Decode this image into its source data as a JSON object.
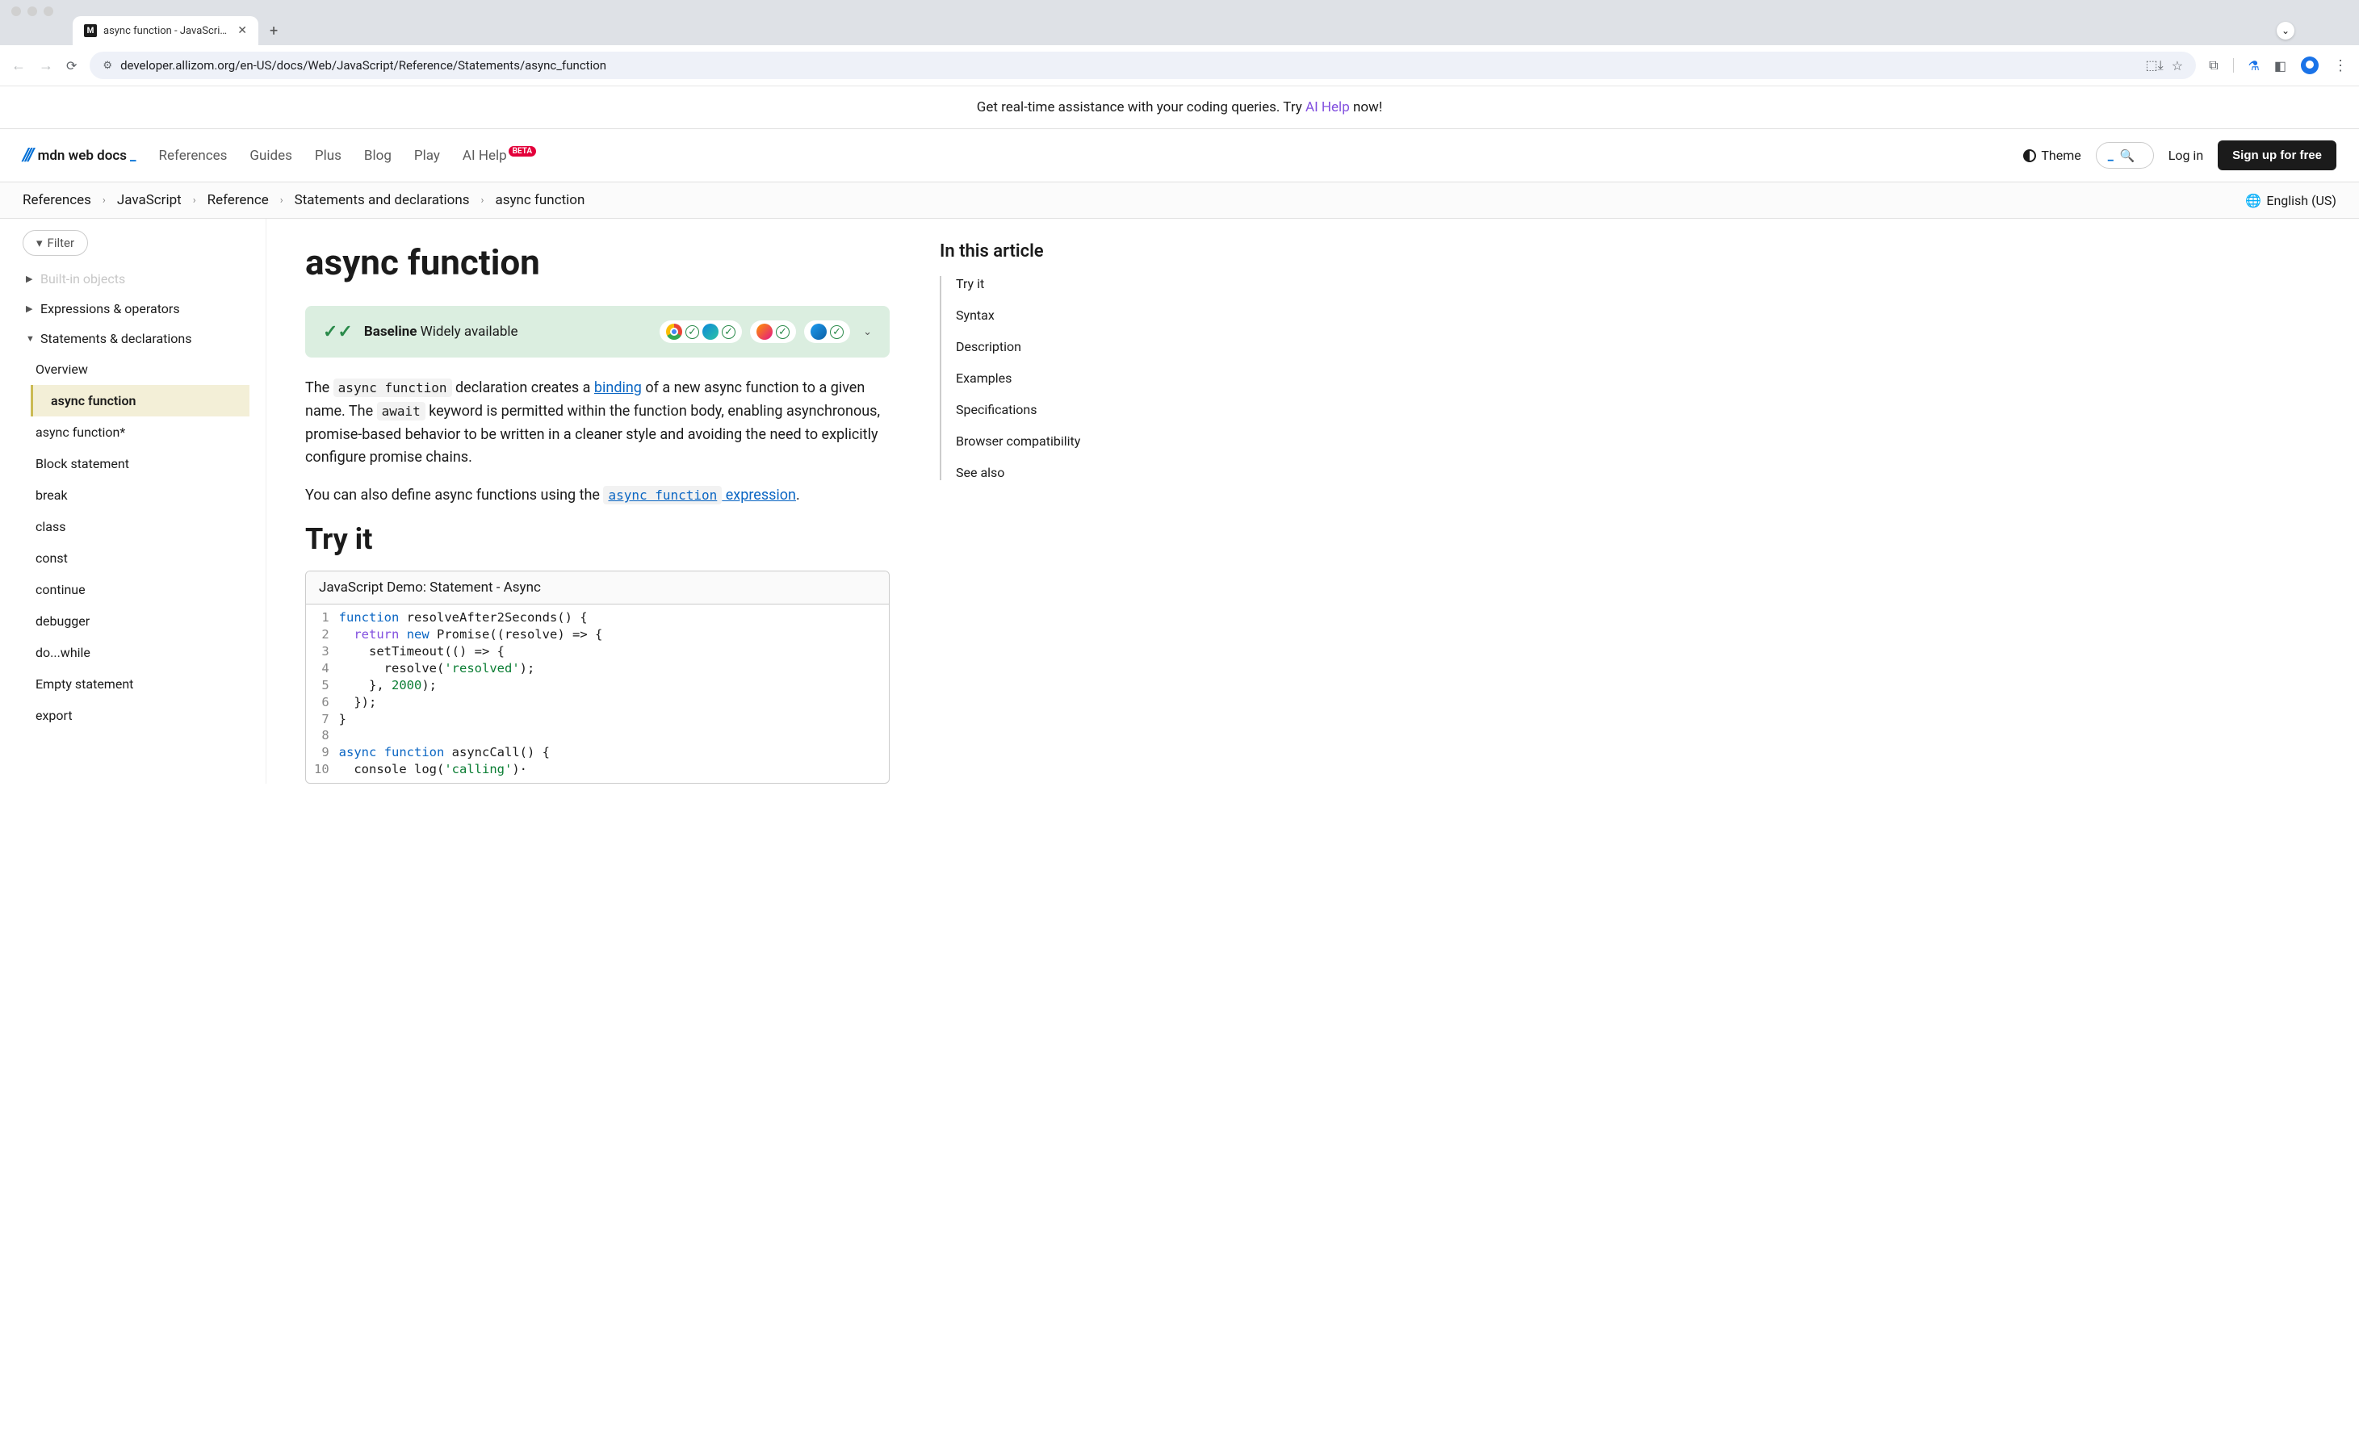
{
  "browser": {
    "tab_title": "async function - JavaScript |",
    "url": "developer.allizom.org/en-US/docs/Web/JavaScript/Reference/Statements/async_function"
  },
  "promo": {
    "pre": "Get real-time assistance with your coding queries. Try ",
    "link": "AI Help",
    "post": " now!"
  },
  "header": {
    "logo_text": "mdn web docs",
    "nav": [
      "References",
      "Guides",
      "Plus",
      "Blog",
      "Play",
      "AI Help"
    ],
    "ai_help_badge": "BETA",
    "theme_label": "Theme",
    "login": "Log in",
    "signup": "Sign up for free"
  },
  "breadcrumbs": [
    "References",
    "JavaScript",
    "Reference",
    "Statements and declarations",
    "async function"
  ],
  "language": "English (US)",
  "sidebar": {
    "filter_label": "Filter",
    "items": [
      {
        "label": "Built-in objects",
        "expanded": false,
        "faded": true
      },
      {
        "label": "Expressions & operators",
        "expanded": false
      },
      {
        "label": "Statements & declarations",
        "expanded": true,
        "children": [
          {
            "label": "Overview"
          },
          {
            "label": "async function",
            "active": true
          },
          {
            "label": "async function*"
          },
          {
            "label": "Block statement"
          },
          {
            "label": "break"
          },
          {
            "label": "class"
          },
          {
            "label": "const"
          },
          {
            "label": "continue"
          },
          {
            "label": "debugger"
          },
          {
            "label": "do...while"
          },
          {
            "label": "Empty statement"
          },
          {
            "label": "export"
          }
        ]
      }
    ]
  },
  "page": {
    "title": "async function",
    "baseline_strong": "Baseline",
    "baseline_rest": " Widely available",
    "intro_1_pre": "The ",
    "intro_1_code1": "async function",
    "intro_1_mid1": " declaration creates a ",
    "intro_1_link1": "binding",
    "intro_1_mid2": " of a new async function to a given name. The ",
    "intro_1_code2": "await",
    "intro_1_tail": " keyword is permitted within the function body, enabling asynchronous, promise-based behavior to be written in a cleaner style and avoiding the need to explicitly configure promise chains.",
    "intro_2_pre": "You can also define async functions using the ",
    "intro_2_linkcode": "async function",
    "intro_2_linktext": " expression",
    "intro_2_tail": ".",
    "try_it_heading": "Try it",
    "demo_header": "JavaScript Demo: Statement - Async",
    "code_lines": [
      {
        "n": "1",
        "tokens": [
          {
            "t": "function",
            "c": "kw"
          },
          {
            "t": " resolveAfter2Seconds() {",
            "c": ""
          }
        ]
      },
      {
        "n": "2",
        "tokens": [
          {
            "t": "  ",
            "c": ""
          },
          {
            "t": "return",
            "c": "kw2"
          },
          {
            "t": " ",
            "c": ""
          },
          {
            "t": "new",
            "c": "kw"
          },
          {
            "t": " Promise((resolve) => {",
            "c": ""
          }
        ]
      },
      {
        "n": "3",
        "tokens": [
          {
            "t": "    setTimeout(() => {",
            "c": ""
          }
        ]
      },
      {
        "n": "4",
        "tokens": [
          {
            "t": "      resolve(",
            "c": ""
          },
          {
            "t": "'resolved'",
            "c": "str"
          },
          {
            "t": ");",
            "c": ""
          }
        ]
      },
      {
        "n": "5",
        "tokens": [
          {
            "t": "    }, ",
            "c": ""
          },
          {
            "t": "2000",
            "c": "num"
          },
          {
            "t": ");",
            "c": ""
          }
        ]
      },
      {
        "n": "6",
        "tokens": [
          {
            "t": "  });",
            "c": ""
          }
        ]
      },
      {
        "n": "7",
        "tokens": [
          {
            "t": "}",
            "c": ""
          }
        ]
      },
      {
        "n": "8",
        "tokens": [
          {
            "t": "",
            "c": ""
          }
        ]
      },
      {
        "n": "9",
        "tokens": [
          {
            "t": "async",
            "c": "kw"
          },
          {
            "t": " ",
            "c": ""
          },
          {
            "t": "function",
            "c": "kw"
          },
          {
            "t": " asyncCall() {",
            "c": ""
          }
        ]
      },
      {
        "n": "10",
        "tokens": [
          {
            "t": "  console log(",
            "c": ""
          },
          {
            "t": "'calling'",
            "c": "str"
          },
          {
            "t": ")·",
            "c": ""
          }
        ]
      }
    ]
  },
  "toc": {
    "heading": "In this article",
    "items": [
      "Try it",
      "Syntax",
      "Description",
      "Examples",
      "Specifications",
      "Browser compatibility",
      "See also"
    ]
  }
}
